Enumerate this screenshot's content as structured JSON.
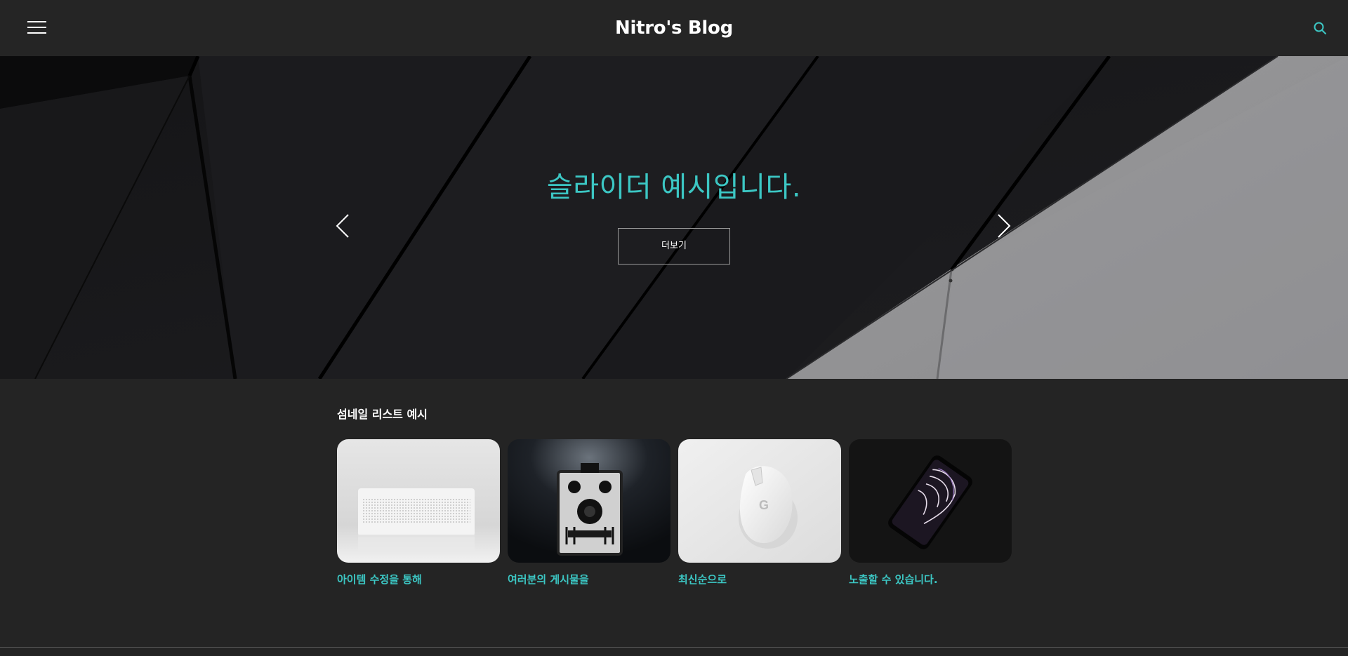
{
  "header": {
    "title": "Nitro's Blog",
    "menu_icon": "hamburger-menu-icon",
    "search_icon": "search-icon",
    "accent_color": "#3cc7c4"
  },
  "hero": {
    "title": "슬라이더 예시입니다.",
    "more_label": "더보기",
    "prev_icon": "chevron-left-icon",
    "next_icon": "chevron-right-icon"
  },
  "thumbnails": {
    "title": "섬네일 리스트 예시",
    "items": [
      {
        "label": "아이템 수정을 통해",
        "image": "white-speaker-photo"
      },
      {
        "label": "여러분의 게시물을",
        "image": "vintage-camera-photo"
      },
      {
        "label": "최신순으로",
        "image": "white-mouse-photo"
      },
      {
        "label": "노출할 수 있습니다.",
        "image": "smartphone-photo"
      }
    ]
  }
}
